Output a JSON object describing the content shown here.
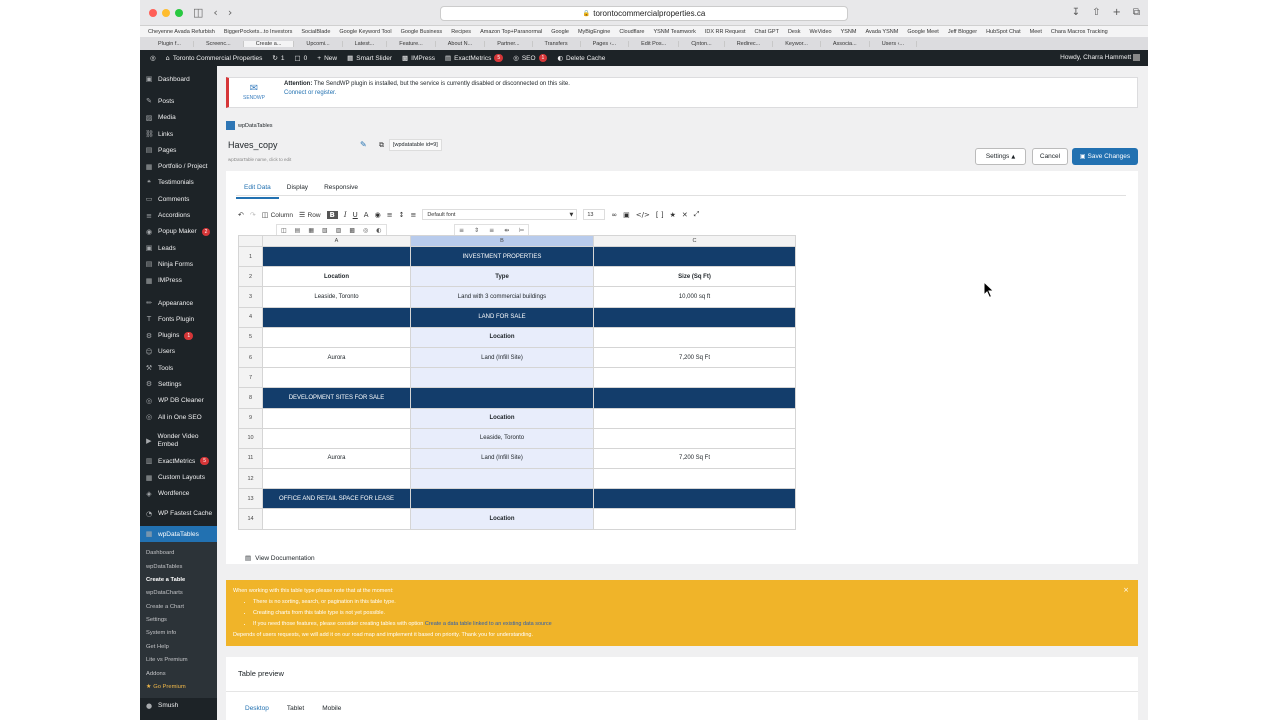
{
  "browser": {
    "url": "torontocommercialproperties.ca",
    "bookmarks": [
      "Cheyenne Avada Refurbish",
      "BiggerPockets...to Investors",
      "SocialBlade",
      "Google Keyword Tool",
      "Google Business",
      "Recipes",
      "Amazon Top+Paranormal",
      "Google",
      "MyBigEngine",
      "Cloudflare",
      "YSNM Teamwork",
      "IDX RR Request",
      "Chat GPT",
      "Desk",
      "WeVideo",
      "YSNM",
      "Avada YSNM",
      "Google Meet",
      "Jeff Blogger",
      "HubSpot Chat",
      "Meet",
      "Chara Macros Tracking"
    ],
    "tabs": [
      "Plugin f...",
      "Screenc...",
      "Create a...",
      "Upcomi...",
      "Latest...",
      "Feature...",
      "About N...",
      "Partner...",
      "Transfers",
      "Pages ‹...",
      "Edit Pos...",
      "Cjnton...",
      "Redirec...",
      "Keywor...",
      "Associa...",
      "Users ‹..."
    ]
  },
  "adminbar": {
    "site": "Toronto Commercial Properties",
    "updates": "1",
    "comments": "0",
    "new": "New",
    "smart_slider": "Smart Slider",
    "impress": "IMPress",
    "exactmetrics": "ExactMetrics",
    "exactmetrics_badge": "5",
    "seo": "SEO",
    "seo_badge": "1",
    "delete_cache": "Delete Cache",
    "howdy": "Howdy, Charra Hammett"
  },
  "sidebar": {
    "items": [
      {
        "label": "Dashboard",
        "icon": "▣"
      },
      {
        "label": "Posts",
        "icon": "✎"
      },
      {
        "label": "Media",
        "icon": "▨"
      },
      {
        "label": "Links",
        "icon": "⛓"
      },
      {
        "label": "Pages",
        "icon": "▤"
      },
      {
        "label": "Portfolio / Project",
        "icon": "▦"
      },
      {
        "label": "Testimonials",
        "icon": "❝"
      },
      {
        "label": "Comments",
        "icon": "▭"
      },
      {
        "label": "Accordions",
        "icon": "≡"
      },
      {
        "label": "Popup Maker",
        "icon": "◉",
        "badge": "2"
      },
      {
        "label": "Leads",
        "icon": "▣"
      },
      {
        "label": "Ninja Forms",
        "icon": "▤"
      },
      {
        "label": "IMPress",
        "icon": "▦"
      },
      {
        "label": "Appearance",
        "icon": "✏"
      },
      {
        "label": "Fonts Plugin",
        "icon": "T"
      },
      {
        "label": "Plugins",
        "icon": "⚙",
        "badge": "1"
      },
      {
        "label": "Users",
        "icon": "☺"
      },
      {
        "label": "Tools",
        "icon": "⚒"
      },
      {
        "label": "Settings",
        "icon": "⚙"
      },
      {
        "label": "WP DB Cleaner",
        "icon": "◎"
      },
      {
        "label": "All in One SEO",
        "icon": "◎"
      },
      {
        "label": "Wonder Video Embed",
        "icon": "▶"
      },
      {
        "label": "ExactMetrics",
        "icon": "▥",
        "badge": "5"
      },
      {
        "label": "Custom Layouts",
        "icon": "▦"
      },
      {
        "label": "Wordfence",
        "icon": "◈"
      },
      {
        "label": "WP Fastest Cache",
        "icon": "◔"
      },
      {
        "label": "wpDataTables",
        "icon": "▦"
      }
    ],
    "submenu": [
      "Dashboard",
      "wpDataTables",
      "Create a Table",
      "wpDataCharts",
      "Create a Chart",
      "Settings",
      "System info",
      "Get Help",
      "Lite vs Premium",
      "Addons",
      "Go Premium"
    ],
    "last": {
      "label": "Smush",
      "icon": "●"
    }
  },
  "notice": {
    "logo": "SENDWP",
    "text_bold": "Attention:",
    "text": "The SendWP plugin is installed, but the service is currently disabled or disconnected on this site.",
    "link": "Connect or register."
  },
  "editor": {
    "brand": "wpDataTables",
    "table_name": "Haves_copy",
    "table_hint": "wpDataTable name, click to edit",
    "shortcode": "[wpdatatable id=9]",
    "settings": "Settings",
    "cancel": "Cancel",
    "save": "Save Changes",
    "tabs": [
      "Edit Data",
      "Display",
      "Responsive"
    ],
    "toolbar": {
      "column": "Column",
      "row": "Row",
      "bold": "B",
      "font": "Default font",
      "size": "13"
    },
    "col_headers": [
      "A",
      "B",
      "C"
    ],
    "rows": [
      {
        "n": "1",
        "dark": true,
        "a": "",
        "b": "INVESTMENT PROPERTIES",
        "c": ""
      },
      {
        "n": "2",
        "a": "Location",
        "b": "Type",
        "c": "Size (Sq Ft)",
        "bold": true
      },
      {
        "n": "3",
        "a": "Leaside, Toronto",
        "b": "Land with 3 commercial buildings",
        "c": "10,000 sq ft"
      },
      {
        "n": "4",
        "dark": true,
        "a": "",
        "b": "LAND FOR SALE",
        "c": ""
      },
      {
        "n": "5",
        "a": "",
        "b": "Location",
        "c": "",
        "bold": true
      },
      {
        "n": "6",
        "a": "Aurora",
        "b": "Land (Infill Site)",
        "c": "7,200 Sq Ft"
      },
      {
        "n": "7",
        "a": "",
        "b": "",
        "c": ""
      },
      {
        "n": "8",
        "dark": true,
        "a": "DEVELOPMENT SITES FOR SALE",
        "b": "",
        "c": ""
      },
      {
        "n": "9",
        "a": "",
        "b": "Location",
        "c": "",
        "bold": true
      },
      {
        "n": "10",
        "a": "",
        "b": "Leaside, Toronto",
        "c": ""
      },
      {
        "n": "11",
        "a": "Aurora",
        "b": "Land (Infill Site)",
        "c": "7,200 Sq Ft"
      },
      {
        "n": "12",
        "a": "",
        "b": "",
        "c": ""
      },
      {
        "n": "13",
        "dark": true,
        "a": "OFFICE AND RETAIL SPACE FOR LEASE",
        "b": "",
        "c": ""
      },
      {
        "n": "14",
        "a": "",
        "b": "Location",
        "c": "",
        "bold": true
      }
    ],
    "doc_link": "View Documentation"
  },
  "warning": {
    "intro": "When working with this table type please note that at the moment:",
    "bullets": [
      "There is no sorting, search, or pagination in this table type.",
      "Creating charts from this table type is not yet possible."
    ],
    "bullet3_pre": "If you need those features, please consider creating tables with option",
    "bullet3_link": "Create a data table linked to an existing data source",
    "outro": "Depends of users requests, we will add it on our road map and implement it based on priority. Thank you for understanding."
  },
  "preview": {
    "title": "Table preview",
    "tabs": [
      "Desktop",
      "Tablet",
      "Mobile"
    ]
  }
}
